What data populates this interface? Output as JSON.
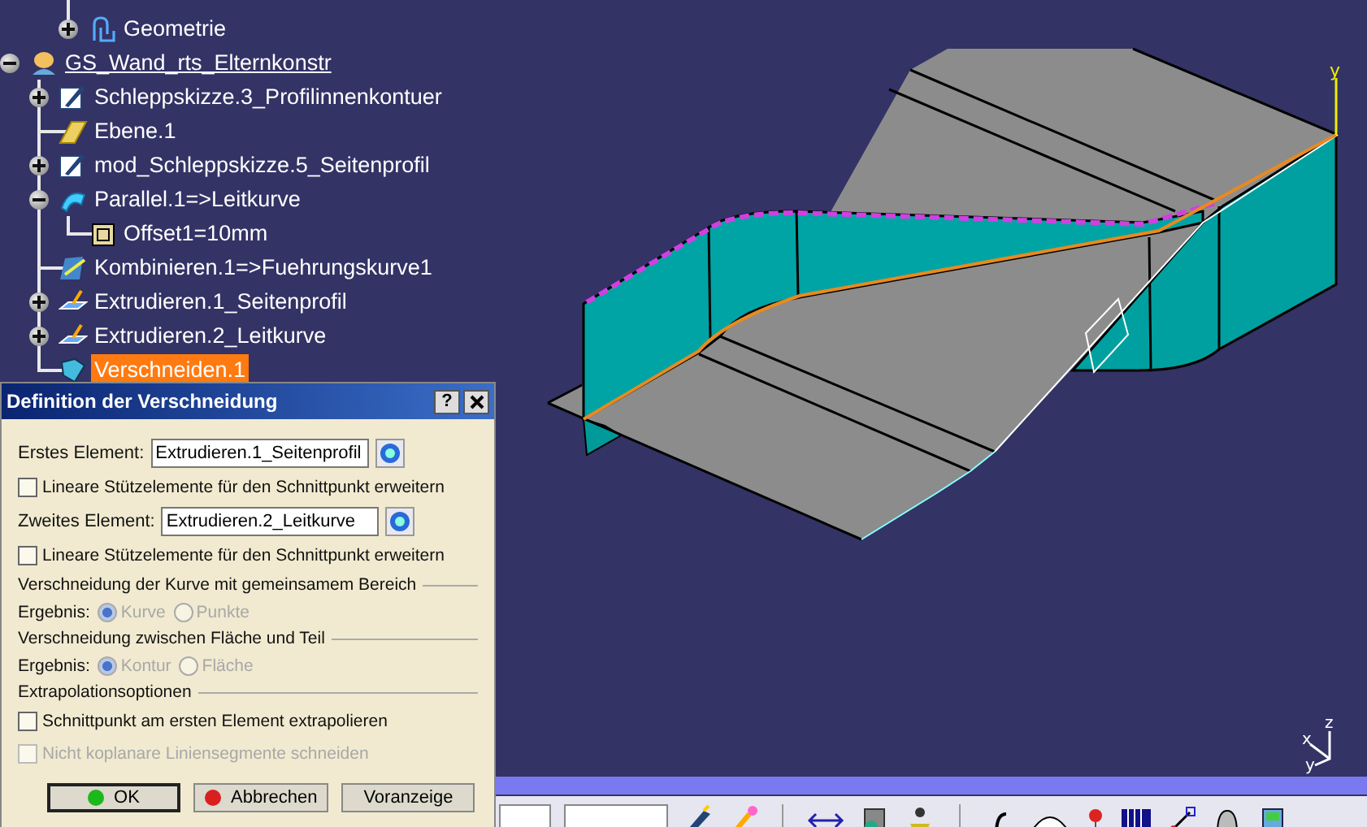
{
  "tree": {
    "cut_off_branch": [
      {
        "label": "Geometrie",
        "kind": "geometry",
        "expanded": false,
        "selected": false,
        "in_work": false
      }
    ],
    "items": [
      {
        "label": "GS_Wand_rts_Elternkonstr",
        "kind": "geometrical_set",
        "expanded": true,
        "selected": false,
        "in_work": true,
        "children": [
          {
            "label": "Schleppskizze.3_Profilinnenkontuer",
            "kind": "sketch",
            "expanded": false,
            "selected": false,
            "in_work": false
          },
          {
            "label": "Ebene.1",
            "kind": "plane",
            "selected": false,
            "in_work": false
          },
          {
            "label": "mod_Schleppskizze.5_Seitenprofil",
            "kind": "sketch",
            "expanded": false,
            "selected": false,
            "in_work": false
          },
          {
            "label": "Parallel.1=>Leitkurve",
            "kind": "parallel",
            "expanded": true,
            "selected": false,
            "in_work": false,
            "children": [
              {
                "label": "Offset1=10mm",
                "kind": "parameter",
                "selected": false,
                "in_work": false
              }
            ]
          },
          {
            "label": "Kombinieren.1=>Fuehrungskurve1",
            "kind": "combine",
            "selected": false,
            "in_work": false
          },
          {
            "label": "Extrudieren.1_Seitenprofil",
            "kind": "extrude",
            "expanded": false,
            "selected": false,
            "in_work": false
          },
          {
            "label": "Extrudieren.2_Leitkurve",
            "kind": "extrude",
            "expanded": false,
            "selected": false,
            "in_work": false
          },
          {
            "label": "Verschneiden.1",
            "kind": "intersect",
            "selected": true,
            "in_work": false
          }
        ]
      }
    ]
  },
  "viewport": {
    "axis_labels": [
      "y"
    ],
    "compass_labels": [
      "z",
      "x",
      "y"
    ]
  },
  "dialog": {
    "title": "Definition der Verschneidung",
    "help_button": "?",
    "rows": [
      {
        "kind": "field",
        "label": "Erstes Element:",
        "value": "Extrudieren.1_Seitenprofil"
      },
      {
        "kind": "checkbox",
        "label": "Lineare Stützelemente für den Schnittpunkt erweitern",
        "checked": false,
        "disabled": false
      },
      {
        "kind": "field",
        "label": "Zweites Element:",
        "value": "Extrudieren.2_Leitkurve"
      },
      {
        "kind": "checkbox",
        "label": "Lineare Stützelemente für den Schnittpunkt erweitern",
        "checked": false,
        "disabled": false
      },
      {
        "kind": "section",
        "label": "Verschneidung der Kurve mit gemeinsamem Bereich"
      },
      {
        "kind": "radio_group",
        "label": "Ergebnis:",
        "disabled": true,
        "options": [
          {
            "label": "Kurve",
            "selected": true
          },
          {
            "label": "Punkte",
            "selected": false
          }
        ]
      },
      {
        "kind": "section",
        "label": "Verschneidung zwischen Fläche und Teil"
      },
      {
        "kind": "radio_group",
        "label": "Ergebnis:",
        "disabled": true,
        "options": [
          {
            "label": "Kontur",
            "selected": true
          },
          {
            "label": "Fläche",
            "selected": false
          }
        ]
      },
      {
        "kind": "section",
        "label": "Extrapolationsoptionen"
      },
      {
        "kind": "checkbox",
        "label": "Schnittpunkt am ersten Element extrapolieren",
        "checked": false,
        "disabled": false
      },
      {
        "kind": "checkbox",
        "label": "Nicht koplanare Liniensegmente schneiden",
        "checked": false,
        "disabled": true
      }
    ],
    "buttons": [
      {
        "label": "OK",
        "kind": "ok",
        "focused": true
      },
      {
        "label": "Abbrechen",
        "kind": "cancel",
        "focused": false
      },
      {
        "label": "Voranzeige",
        "kind": "plain",
        "focused": false
      }
    ]
  }
}
